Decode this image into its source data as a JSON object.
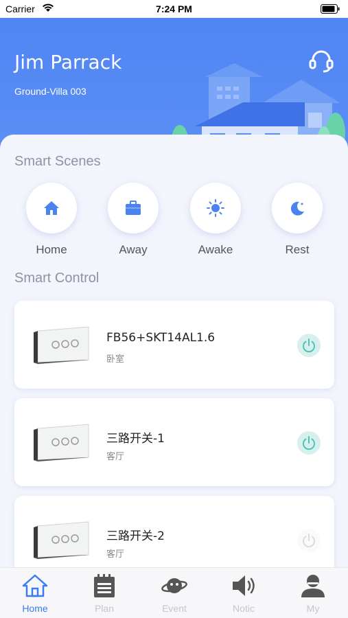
{
  "status_bar": {
    "carrier": "Carrier",
    "time": "7:24 PM"
  },
  "header": {
    "user_name": "Jim Parrack",
    "location": "Ground-Villa 003"
  },
  "smart_scenes": {
    "title": "Smart Scenes",
    "items": [
      {
        "label": "Home",
        "icon": "home-icon"
      },
      {
        "label": "Away",
        "icon": "bag-icon"
      },
      {
        "label": "Awake",
        "icon": "sun-icon"
      },
      {
        "label": "Rest",
        "icon": "moon-icon"
      }
    ]
  },
  "smart_control": {
    "title": "Smart Control",
    "devices": [
      {
        "name": "FB56+SKT14AL1.6",
        "room": "卧室",
        "power": "on"
      },
      {
        "name": "三路开关-1",
        "room": "客厅",
        "power": "on"
      },
      {
        "name": "三路开关-2",
        "room": "客厅",
        "power": "off"
      }
    ]
  },
  "tab_bar": {
    "items": [
      {
        "label": "Home",
        "icon": "home-icon",
        "active": true
      },
      {
        "label": "Plan",
        "icon": "calendar-icon",
        "active": false
      },
      {
        "label": "Event",
        "icon": "planet-icon",
        "active": false
      },
      {
        "label": "Notic",
        "icon": "speaker-icon",
        "active": false
      },
      {
        "label": "My",
        "icon": "user-icon",
        "active": false
      }
    ]
  },
  "colors": {
    "accent": "#3a7af2",
    "header_bg": "#5289f4",
    "power_on": "#4fc3b6",
    "inactive": "#c3c6cf"
  }
}
